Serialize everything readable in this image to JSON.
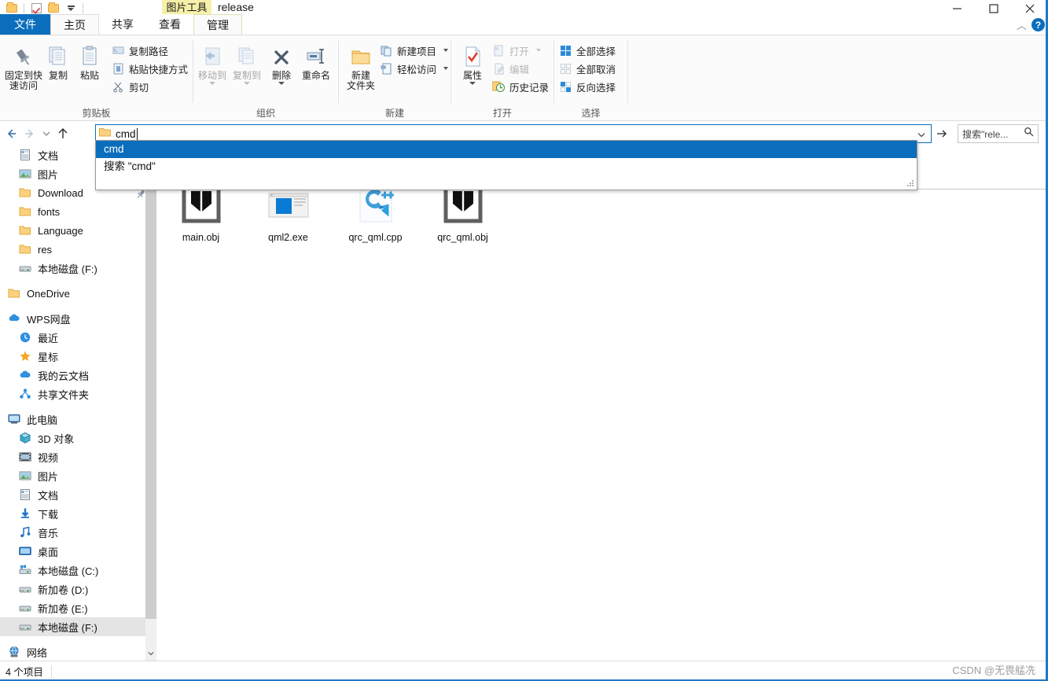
{
  "window": {
    "title": "release",
    "contextual_tab": "图片工具",
    "minimize": "minimize-icon",
    "maximize": "maximize-icon",
    "close": "close-icon"
  },
  "quick_access": {
    "items": [
      {
        "name": "folder-icon",
        "label": ""
      },
      {
        "name": "properties-check-icon",
        "label": ""
      },
      {
        "name": "new-folder-icon",
        "label": ""
      },
      {
        "name": "customize-dropdown-icon",
        "label": ""
      }
    ]
  },
  "tabs": [
    {
      "id": "file",
      "label": "文件"
    },
    {
      "id": "home",
      "label": "主页"
    },
    {
      "id": "share",
      "label": "共享"
    },
    {
      "id": "view",
      "label": "查看"
    },
    {
      "id": "manage",
      "label": "管理"
    }
  ],
  "ribbon": {
    "groups": [
      {
        "id": "clipboard",
        "label": "剪贴板",
        "big_buttons": [
          {
            "label": "固定到快\n速访问",
            "line1": "固定到快",
            "line2": "速访问",
            "icon": "pin-icon",
            "dim": false
          },
          {
            "label": "复制",
            "line1": "复制",
            "line2": "",
            "icon": "copy-icon",
            "dim": false
          },
          {
            "label": "粘贴",
            "line1": "粘贴",
            "line2": "",
            "icon": "paste-icon",
            "dim": false
          }
        ],
        "small_buttons": [
          {
            "label": "复制路径",
            "icon": "copy-path-icon",
            "dim": false
          },
          {
            "label": "粘贴快捷方式",
            "icon": "paste-shortcut-icon",
            "dim": false
          },
          {
            "label": "剪切",
            "icon": "cut-scissors-icon",
            "dim": false
          }
        ]
      },
      {
        "id": "organize",
        "label": "组织",
        "big_buttons": [
          {
            "label": "移动到",
            "line1": "移动到",
            "line2": "",
            "icon": "move-to-icon",
            "dim": true,
            "caret": true
          },
          {
            "label": "复制到",
            "line1": "复制到",
            "line2": "",
            "icon": "copy-to-icon",
            "dim": true,
            "caret": true
          },
          {
            "label": "删除",
            "line1": "删除",
            "line2": "",
            "icon": "delete-x-icon",
            "dim": false,
            "caret": true
          },
          {
            "label": "重命名",
            "line1": "重命名",
            "line2": "",
            "icon": "rename-icon",
            "dim": false,
            "caret": false
          }
        ],
        "small_buttons": []
      },
      {
        "id": "new",
        "label": "新建",
        "big_buttons": [
          {
            "label": "新建文件夹",
            "line1": "新建",
            "line2": "文件夹",
            "icon": "new-folder-big-icon",
            "dim": false
          }
        ],
        "small_buttons": [
          {
            "label": "新建项目",
            "icon": "new-item-icon",
            "dim": false,
            "caret": true
          },
          {
            "label": "轻松访问",
            "icon": "easy-access-icon",
            "dim": false,
            "caret": true
          }
        ]
      },
      {
        "id": "open",
        "label": "打开",
        "big_buttons": [
          {
            "label": "属性",
            "line1": "属性",
            "line2": "",
            "icon": "properties-icon",
            "dim": false,
            "caret": true
          }
        ],
        "small_buttons": [
          {
            "label": "打开",
            "icon": "open-icon",
            "dim": true,
            "caret": true
          },
          {
            "label": "编辑",
            "icon": "edit-icon",
            "dim": true
          },
          {
            "label": "历史记录",
            "icon": "history-icon",
            "dim": false
          }
        ]
      },
      {
        "id": "select",
        "label": "选择",
        "big_buttons": [],
        "small_buttons": [
          {
            "label": "全部选择",
            "icon": "select-all-icon",
            "dim": false
          },
          {
            "label": "全部取消",
            "icon": "select-none-icon",
            "dim": true
          },
          {
            "label": "反向选择",
            "icon": "invert-selection-icon",
            "dim": false
          }
        ]
      }
    ]
  },
  "navigation": {
    "back": "back-arrow-icon",
    "forward": "forward-arrow-icon",
    "recent": "recent-locations-icon",
    "up": "up-arrow-icon"
  },
  "address_bar": {
    "value": "cmd",
    "folder_icon": "folder-icon",
    "dropdown_icon": "chevron-down-icon",
    "go_icon": "go-arrow-icon"
  },
  "search": {
    "placeholder": "搜索\"rele...",
    "icon": "search-icon"
  },
  "autocomplete": {
    "items": [
      {
        "label": "cmd",
        "selected": true
      },
      {
        "label": "搜索 \"cmd\"",
        "selected": false
      }
    ]
  },
  "sidebar": {
    "groups": [
      {
        "items": [
          {
            "label": "文档",
            "icon": "documents-icon",
            "indent": 1,
            "selected": false
          },
          {
            "label": "图片",
            "icon": "pictures-icon",
            "indent": 1,
            "selected": false
          },
          {
            "label": "Download",
            "icon": "folder-icon",
            "indent": 1,
            "selected": false
          },
          {
            "label": "fonts",
            "icon": "folder-icon",
            "indent": 1,
            "selected": false
          },
          {
            "label": "Language",
            "icon": "folder-icon",
            "indent": 1,
            "selected": false
          },
          {
            "label": "res",
            "icon": "folder-icon",
            "indent": 1,
            "selected": false
          },
          {
            "label": "本地磁盘 (F:)",
            "icon": "drive-icon",
            "indent": 1,
            "selected": false
          }
        ]
      },
      {
        "items": [
          {
            "label": "OneDrive",
            "icon": "onedrive-folder-icon",
            "indent": 0,
            "selected": false
          }
        ]
      },
      {
        "items": [
          {
            "label": "WPS网盘",
            "icon": "wps-cloud-icon",
            "indent": 0,
            "selected": false
          },
          {
            "label": "最近",
            "icon": "recent-clock-icon",
            "indent": 1,
            "selected": false
          },
          {
            "label": "星标",
            "icon": "star-icon",
            "indent": 1,
            "selected": false
          },
          {
            "label": "我的云文档",
            "icon": "cloud-icon",
            "indent": 1,
            "selected": false
          },
          {
            "label": "共享文件夹",
            "icon": "shared-folder-icon",
            "indent": 1,
            "selected": false
          }
        ]
      },
      {
        "items": [
          {
            "label": "此电脑",
            "icon": "this-pc-icon",
            "indent": 0,
            "selected": false
          },
          {
            "label": "3D 对象",
            "icon": "3d-objects-icon",
            "indent": 1,
            "selected": false
          },
          {
            "label": "视频",
            "icon": "videos-icon",
            "indent": 1,
            "selected": false
          },
          {
            "label": "图片",
            "icon": "pictures-icon",
            "indent": 1,
            "selected": false
          },
          {
            "label": "文档",
            "icon": "documents-icon",
            "indent": 1,
            "selected": false
          },
          {
            "label": "下载",
            "icon": "downloads-icon",
            "indent": 1,
            "selected": false
          },
          {
            "label": "音乐",
            "icon": "music-icon",
            "indent": 1,
            "selected": false
          },
          {
            "label": "桌面",
            "icon": "desktop-icon",
            "indent": 1,
            "selected": false
          },
          {
            "label": "本地磁盘 (C:)",
            "icon": "windows-drive-icon",
            "indent": 1,
            "selected": false
          },
          {
            "label": "新加卷 (D:)",
            "icon": "drive-icon",
            "indent": 1,
            "selected": false
          },
          {
            "label": "新加卷 (E:)",
            "icon": "drive-icon",
            "indent": 1,
            "selected": false
          },
          {
            "label": "本地磁盘 (F:)",
            "icon": "drive-icon",
            "indent": 1,
            "selected": true
          }
        ]
      },
      {
        "items": [
          {
            "label": "网络",
            "icon": "network-icon",
            "indent": 0,
            "selected": false
          }
        ]
      }
    ]
  },
  "files": [
    {
      "name": "main.obj",
      "icon": "obj-file-icon"
    },
    {
      "name": "qml2.exe",
      "icon": "exe-window-icon"
    },
    {
      "name": "qrc_qml.cpp",
      "icon": "cpp-vscode-icon"
    },
    {
      "name": "qrc_qml.obj",
      "icon": "obj-file-icon"
    }
  ],
  "status": {
    "item_count": "4 个项目"
  },
  "watermark": "CSDN @无畏艋冼",
  "colors": {
    "accent": "#0a6ebd",
    "selection": "#0a6ebd",
    "ribbon_bg": "#fbfbfb",
    "contextual_tab": "#f7f0a8",
    "sidebar_selected": "#e4e4e4"
  }
}
